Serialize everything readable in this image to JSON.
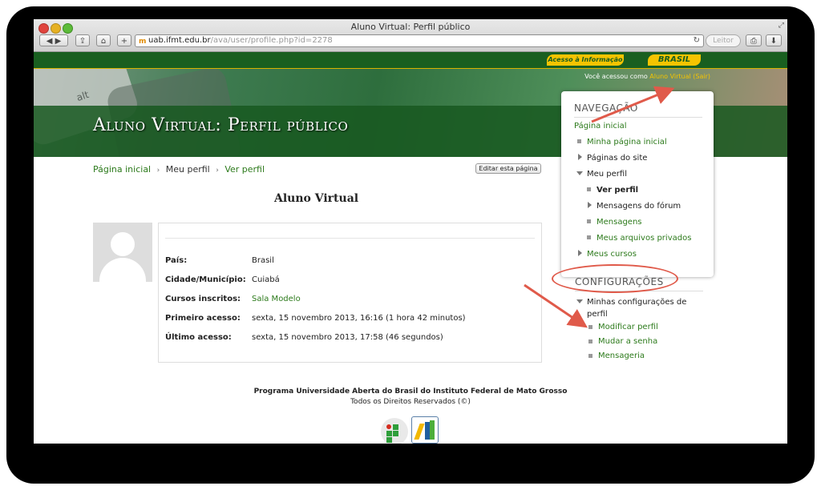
{
  "browser": {
    "window_title": "Aluno Virtual: Perfil público",
    "url_host": "uab.ifmt.edu.br",
    "url_path": "/ava/user/profile.php?id=2278",
    "reader_label": "Leitor",
    "favicon": "m"
  },
  "header": {
    "gov_link_label": "Acesso à Informação",
    "brasil_label": "BRASIL",
    "logged_in_prefix": "Você acessou como ",
    "logged_in_user": "Aluno Virtual",
    "logout_label": "(Sair)",
    "page_title": "Aluno Virtual: Perfil público",
    "banner_key_text": "alt"
  },
  "breadcrumb": {
    "home": "Página inicial",
    "profile": "Meu perfil",
    "view": "Ver perfil",
    "separator": "›"
  },
  "edit_page_label": "Editar esta página",
  "profile": {
    "name": "Aluno Virtual",
    "fields": [
      {
        "label": "País:",
        "value": "Brasil"
      },
      {
        "label": "Cidade/Município:",
        "value": "Cuiabá"
      },
      {
        "label": "Cursos inscritos:",
        "value": "Sala Modelo"
      },
      {
        "label": "Primeiro acesso:",
        "value": "sexta, 15 novembro 2013, 16:16  (1 hora 42 minutos)"
      },
      {
        "label": "Último acesso:",
        "value": "sexta, 15 novembro 2013, 17:58  (46 segundos)"
      }
    ]
  },
  "navigation": {
    "title": "NAVEGAÇÃO",
    "home": "Página inicial",
    "my_home": "Minha página inicial",
    "site_pages": "Páginas do site",
    "my_profile": "Meu perfil",
    "view_profile": "Ver perfil",
    "forum_posts": "Mensagens do fórum",
    "messages": "Mensagens",
    "private_files": "Meus arquivos privados",
    "my_courses": "Meus cursos"
  },
  "settings": {
    "title": "CONFIGURAÇÕES",
    "my_profile_settings": "Minhas configurações de perfil",
    "edit_profile": "Modificar perfil",
    "change_password": "Mudar a senha",
    "messaging": "Mensageria"
  },
  "footer": {
    "line1": "Programa Universidade Aberta do Brasil do Instituto Federal de Mato Grosso",
    "line2": "Todos os Direitos Reservados (©)"
  },
  "colors": {
    "link_green": "#2c7a1b",
    "header_green": "#195f20",
    "accent_yellow": "#f5c400",
    "annotation_red": "#e05a4a"
  }
}
